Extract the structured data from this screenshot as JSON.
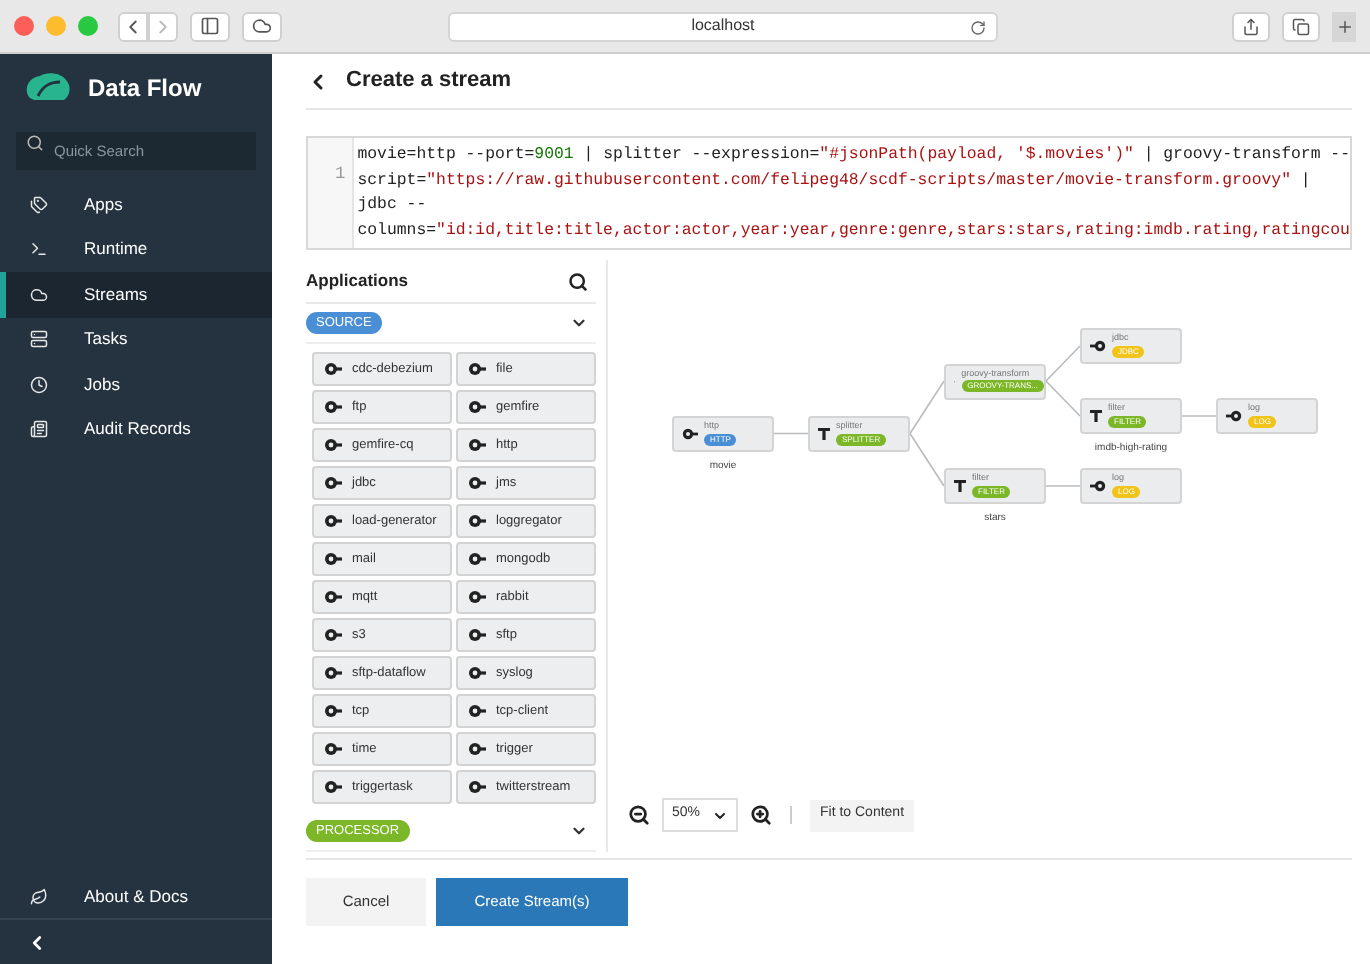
{
  "browser": {
    "url": "localhost"
  },
  "sidebar": {
    "brand": "Data Flow",
    "search": {
      "placeholder": "Quick Search"
    },
    "items": [
      {
        "label": "Apps",
        "selected": false
      },
      {
        "label": "Runtime",
        "selected": false
      },
      {
        "label": "Streams",
        "selected": true
      },
      {
        "label": "Tasks",
        "selected": false
      },
      {
        "label": "Jobs",
        "selected": false
      },
      {
        "label": "Audit Records",
        "selected": false
      }
    ],
    "footer": {
      "label": "About & Docs"
    }
  },
  "page": {
    "title": "Create a stream"
  },
  "editor": {
    "line_number": "1",
    "lines": [
      {
        "tokens": [
          {
            "kind": "text",
            "text": "movie=http --port="
          },
          {
            "kind": "number",
            "text": "9001"
          },
          {
            "kind": "text",
            "text": " | splitter --expression="
          },
          {
            "kind": "string",
            "text": "\"#jsonPath(payload, '$.movies')\""
          },
          {
            "kind": "text",
            "text": " | groovy-transform --"
          }
        ]
      },
      {
        "tokens": [
          {
            "kind": "text",
            "text": "script="
          },
          {
            "kind": "string",
            "text": "\"https://raw.githubusercontent.com/felipeg48/scdf-scripts/master/movie-transform.groovy\""
          },
          {
            "kind": "text",
            "text": " |"
          }
        ]
      },
      {
        "tokens": [
          {
            "kind": "text",
            "text": "jdbc --"
          }
        ]
      },
      {
        "tokens": [
          {
            "kind": "text",
            "text": "columns="
          },
          {
            "kind": "string",
            "text": "\"id:id,title:title,actor:actor,year:year,genre:genre,stars:stars,rating:imdb.rating,ratingcou"
          }
        ]
      }
    ]
  },
  "palette": {
    "title": "Applications",
    "groups": [
      {
        "label": "SOURCE",
        "kind": "source",
        "apps": [
          "cdc-debezium",
          "file",
          "ftp",
          "gemfire",
          "gemfire-cq",
          "http",
          "jdbc",
          "jms",
          "load-generator",
          "loggregator",
          "mail",
          "mongodb",
          "mqtt",
          "rabbit",
          "s3",
          "sftp",
          "sftp-dataflow",
          "syslog",
          "tcp",
          "tcp-client",
          "time",
          "trigger",
          "triggertask",
          "twitterstream"
        ]
      },
      {
        "label": "PROCESSOR",
        "kind": "processor"
      }
    ]
  },
  "graph": {
    "nodes": [
      {
        "kind": "source",
        "name": "http",
        "badge": "HTTP",
        "label": "movie",
        "children": [
          {
            "kind": "processor",
            "name": "splitter",
            "badge": "SPLITTER",
            "children": [
              {
                "kind": "processor",
                "name": "groovy-transform",
                "badge": "GROOVY-TRANS...",
                "children": [
                  {
                    "kind": "sink",
                    "name": "jdbc",
                    "badge": "JDBC"
                  },
                  {
                    "kind": "processor",
                    "name": "filter",
                    "badge": "FILTER",
                    "label": "imdb-high-rating",
                    "children": [
                      {
                        "kind": "sink",
                        "name": "log",
                        "badge": "LOG"
                      }
                    ]
                  }
                ]
              },
              {
                "kind": "processor",
                "name": "filter",
                "badge": "FILTER",
                "label": "stars",
                "children": [
                  {
                    "kind": "sink",
                    "name": "log",
                    "badge": "LOG"
                  }
                ]
              }
            ]
          }
        ]
      }
    ]
  },
  "zoom": {
    "value": "50%",
    "fit_button": "Fit to Content"
  },
  "actions": {
    "cancel": "Cancel",
    "create": "Create Stream(s)"
  }
}
